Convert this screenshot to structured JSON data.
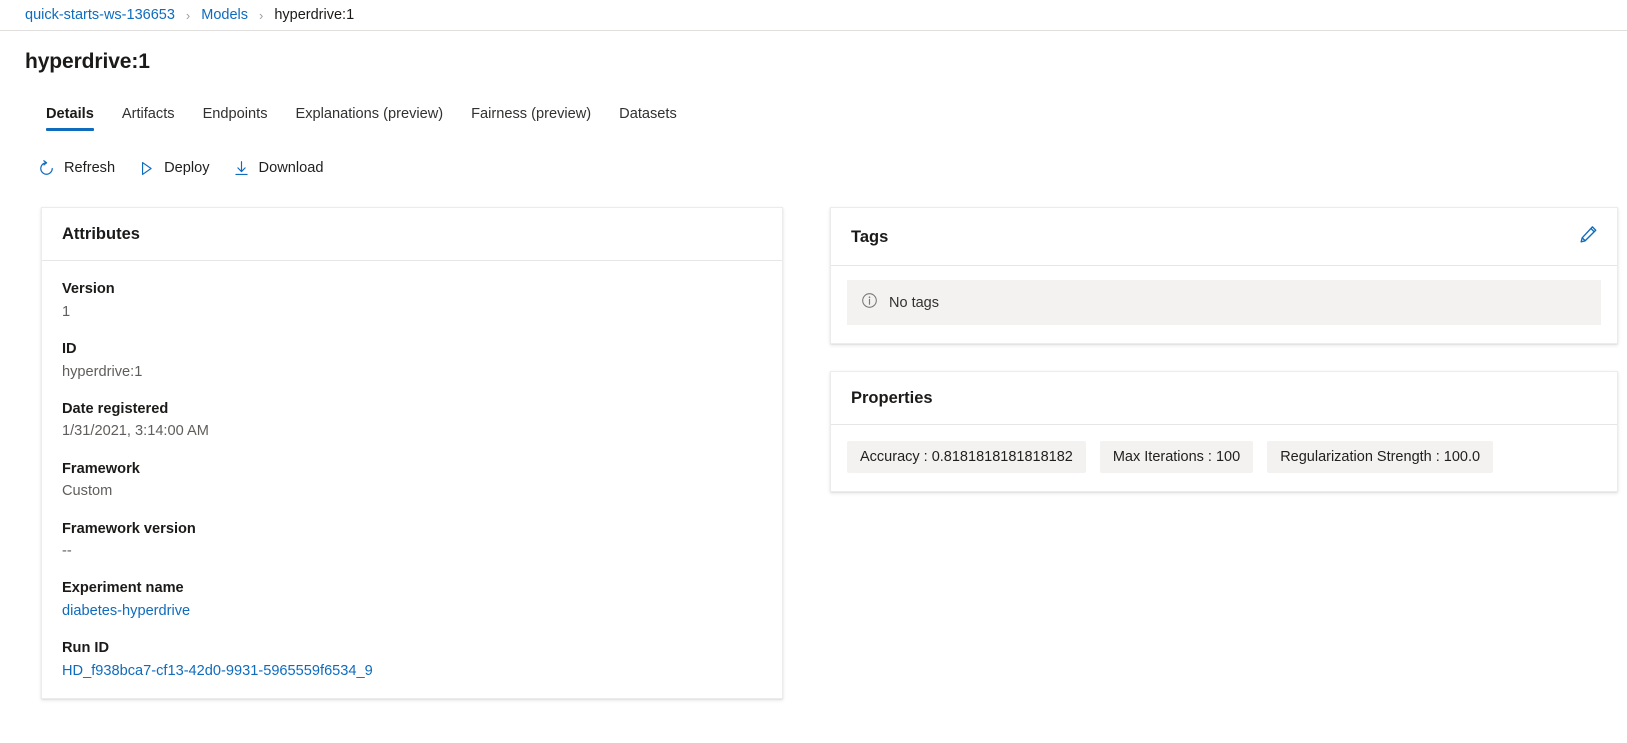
{
  "breadcrumb": {
    "items": [
      {
        "label": "quick-starts-ws-136653",
        "type": "link"
      },
      {
        "label": "Models",
        "type": "link"
      },
      {
        "label": "hyperdrive:1",
        "type": "current"
      }
    ],
    "separator": "›"
  },
  "page": {
    "title": "hyperdrive:1"
  },
  "tabs": [
    {
      "label": "Details",
      "active": true
    },
    {
      "label": "Artifacts",
      "active": false
    },
    {
      "label": "Endpoints",
      "active": false
    },
    {
      "label": "Explanations (preview)",
      "active": false
    },
    {
      "label": "Fairness (preview)",
      "active": false
    },
    {
      "label": "Datasets",
      "active": false
    }
  ],
  "command_bar": [
    {
      "label": "Refresh",
      "icon": "refresh-icon"
    },
    {
      "label": "Deploy",
      "icon": "play-triangle-icon"
    },
    {
      "label": "Download",
      "icon": "download-arrow-icon"
    }
  ],
  "attributes": {
    "title": "Attributes",
    "rows": [
      {
        "label": "Version",
        "value": "1",
        "is_link": false
      },
      {
        "label": "ID",
        "value": "hyperdrive:1",
        "is_link": false
      },
      {
        "label": "Date registered",
        "value": "1/31/2021, 3:14:00 AM",
        "is_link": false
      },
      {
        "label": "Framework",
        "value": "Custom",
        "is_link": false
      },
      {
        "label": "Framework version",
        "value": "--",
        "is_link": false
      },
      {
        "label": "Experiment name",
        "value": "diabetes-hyperdrive",
        "is_link": true
      },
      {
        "label": "Run ID",
        "value": "HD_f938bca7-cf13-42d0-9931-5965559f6534_9",
        "is_link": true
      }
    ]
  },
  "tags": {
    "title": "Tags",
    "edit_icon": "pencil-edit-icon",
    "empty_message": "No tags",
    "info_icon": "info-circle-icon"
  },
  "properties": {
    "title": "Properties",
    "chips": [
      "Accuracy : 0.8181818181818182",
      "Max Iterations : 100",
      "Regularization Strength : 100.0"
    ]
  },
  "colors": {
    "accent": "#0f6cbd",
    "link": "#0f6cbd",
    "text_primary": "#1b1a19",
    "text_secondary": "#605e5c",
    "neutral_bg": "#f3f2f1"
  }
}
